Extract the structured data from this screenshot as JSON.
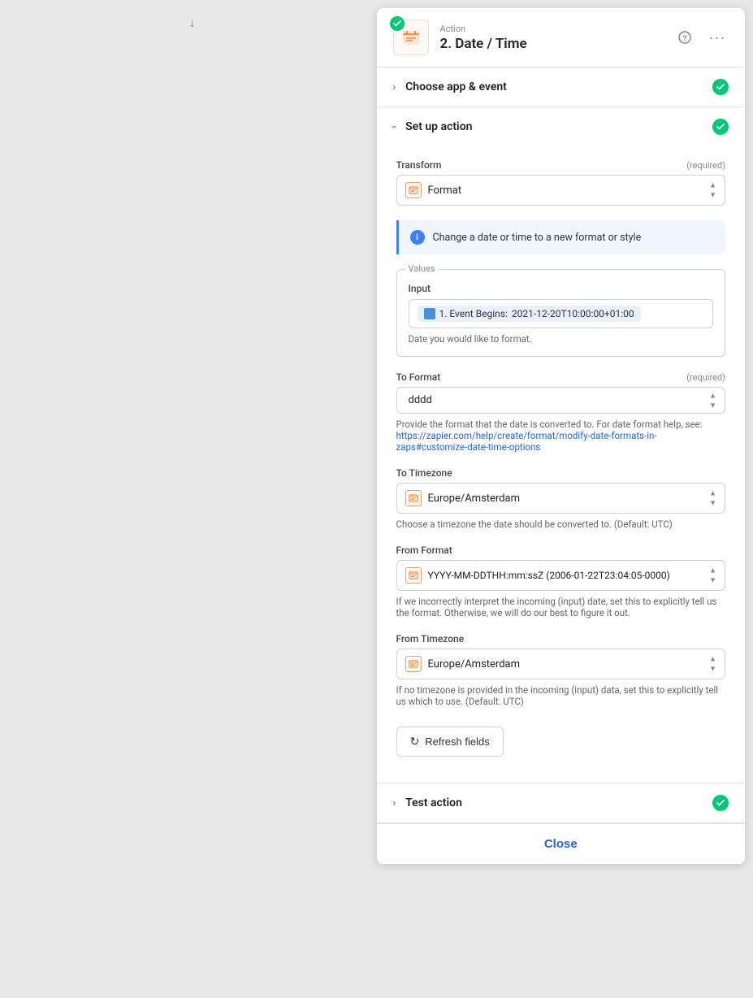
{
  "top_arrow": "↓",
  "header": {
    "action_label": "Action",
    "title": "2. Date / Time",
    "help_icon": "?",
    "more_icon": "•••"
  },
  "sections": {
    "choose_app": {
      "label": "Choose app & event",
      "collapsed": true
    },
    "setup_action": {
      "label": "Set up action",
      "collapsed": false
    },
    "test_action": {
      "label": "Test action",
      "collapsed": true
    }
  },
  "form": {
    "transform": {
      "label": "Transform",
      "required": "(required)",
      "value": "Format"
    },
    "info_message": "Change a date or time to a new format or style",
    "values": {
      "legend": "Values",
      "input_label": "Input",
      "input_tag_label": "1. Event Begins:",
      "input_tag_value": "2021-12-20T10:00:00+01:00",
      "input_hint": "Date you would like to format."
    },
    "to_format": {
      "label": "To Format",
      "required": "(required)",
      "value": "dddd",
      "hint_text": "Provide the format that the date is converted to. For date format help, see:",
      "hint_link": "https://zapier.com/help/create/format/modify-date-formats-in-zaps#customize-date-time-options",
      "hint_link_text": "https://zapier.com/help/create/format/modify-date-formats-in-zaps#customize-date-time-options"
    },
    "to_timezone": {
      "label": "To Timezone",
      "value": "Europe/Amsterdam",
      "hint": "Choose a timezone the date should be converted to. (Default: UTC)"
    },
    "from_format": {
      "label": "From Format",
      "value": "YYYY-MM-DDTHH:mm:ssZ (2006-01-22T23:04:05-0000)",
      "hint": "If we incorrectly interpret the incoming (input) date, set this to explicitly tell us the format. Otherwise, we will do our best to figure it out."
    },
    "from_timezone": {
      "label": "From Timezone",
      "value": "Europe/Amsterdam",
      "hint": "If no timezone is provided in the incoming (input) data, set this to explicitly tell us which to use. (Default: UTC)"
    },
    "refresh_button": "Refresh fields"
  },
  "footer": {
    "close_label": "Close"
  }
}
